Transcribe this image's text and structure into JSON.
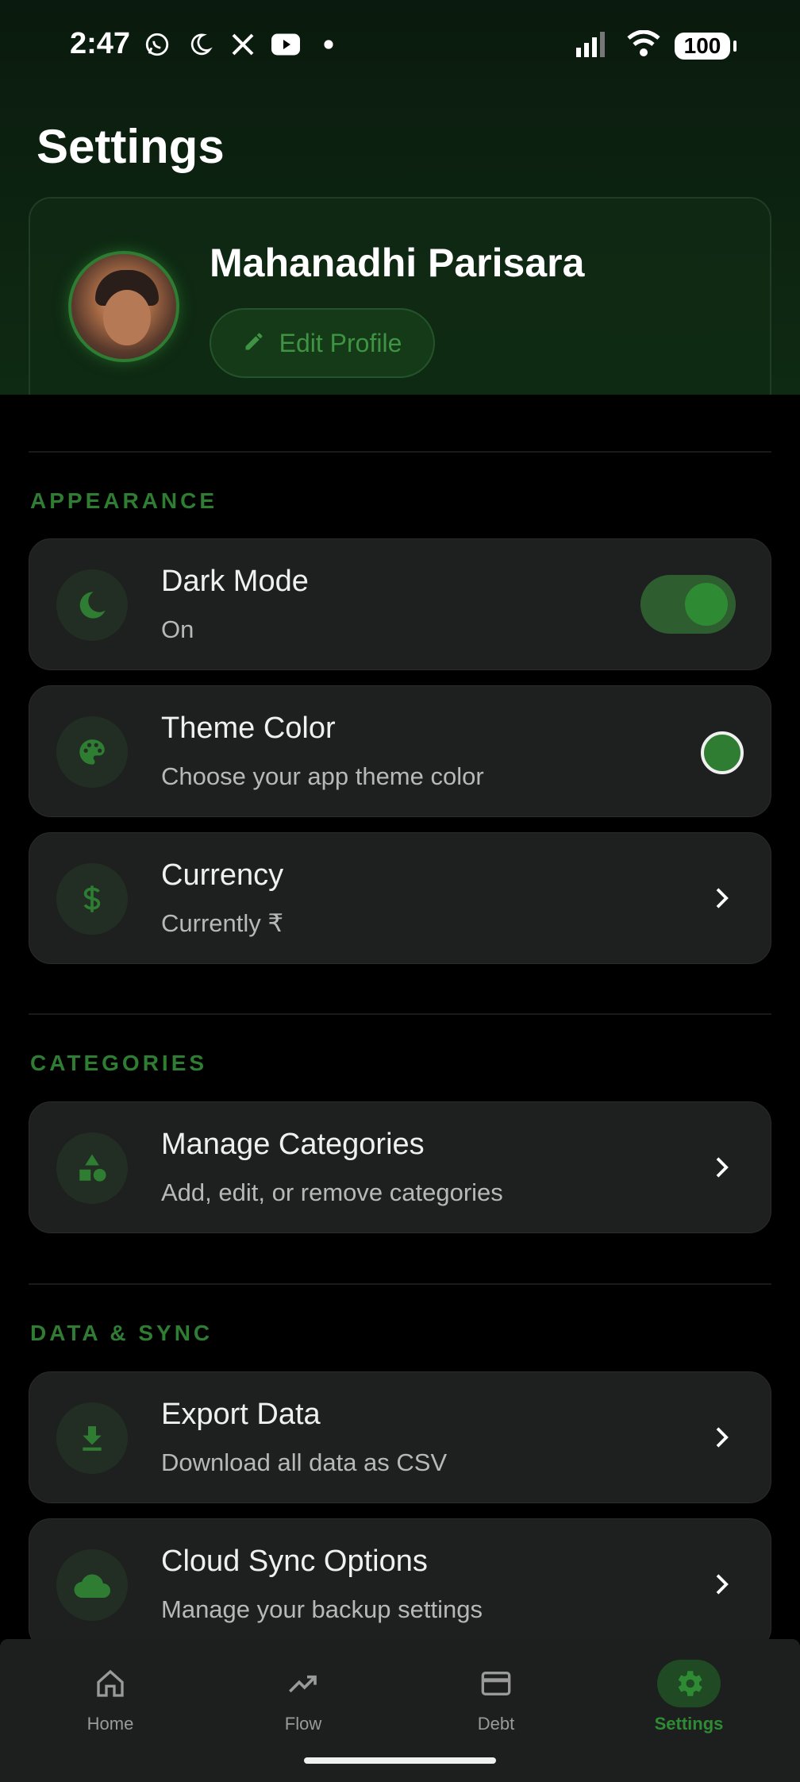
{
  "status_bar": {
    "time": "2:47",
    "battery": "100",
    "left_icons": [
      "whatsapp-icon",
      "moon-icon",
      "x-icon",
      "youtube-icon",
      "dot-icon"
    ],
    "right_icons": [
      "signal-icon",
      "wifi-icon",
      "battery-icon"
    ]
  },
  "header": {
    "title": "Settings"
  },
  "profile": {
    "name": "Mahanadhi Parisara",
    "edit_label": "Edit Profile"
  },
  "sections": {
    "appearance": {
      "label": "APPEARANCE",
      "dark_mode": {
        "title": "Dark Mode",
        "subtitle": "On",
        "enabled": true
      },
      "theme_color": {
        "title": "Theme Color",
        "subtitle": "Choose your app theme color",
        "color": "#2e7d32"
      },
      "currency": {
        "title": "Currency",
        "subtitle": "Currently ₹"
      }
    },
    "categories": {
      "label": "CATEGORIES",
      "manage": {
        "title": "Manage Categories",
        "subtitle": "Add, edit, or remove categories"
      }
    },
    "data_sync": {
      "label": "DATA & SYNC",
      "export": {
        "title": "Export Data",
        "subtitle": "Download all data as CSV"
      },
      "cloud": {
        "title": "Cloud Sync Options",
        "subtitle": "Manage your backup settings"
      }
    }
  },
  "bottom_nav": {
    "items": [
      {
        "label": "Home",
        "icon": "home-icon",
        "active": false
      },
      {
        "label": "Flow",
        "icon": "trending-up-icon",
        "active": false
      },
      {
        "label": "Debt",
        "icon": "credit-card-icon",
        "active": false
      },
      {
        "label": "Settings",
        "icon": "gear-icon",
        "active": true
      }
    ]
  },
  "colors": {
    "accent": "#2e7d32",
    "background": "#000000",
    "card": "#1e201f",
    "header_bg": "#0d2411"
  }
}
